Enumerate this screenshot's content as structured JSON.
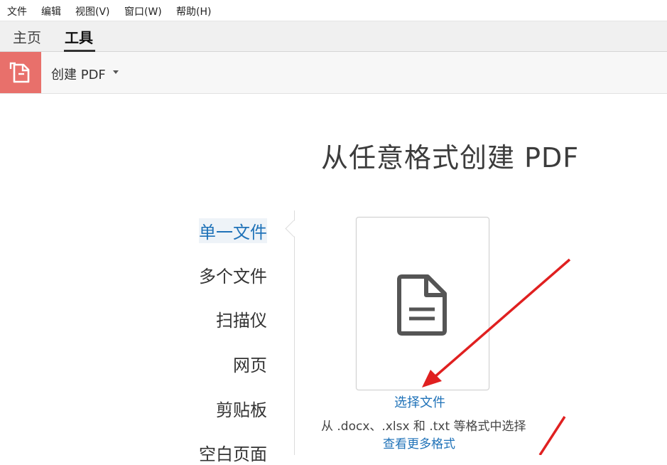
{
  "menubar": {
    "items": [
      "文件",
      "编辑",
      "视图(V)",
      "窗口(W)",
      "帮助(H)"
    ]
  },
  "tabs": [
    {
      "label": "主页"
    },
    {
      "label": "工具"
    }
  ],
  "toolbar": {
    "tool_name": "创建 PDF"
  },
  "main": {
    "title": "从任意格式创建 PDF",
    "options": [
      "单一文件",
      "多个文件",
      "扫描仪",
      "网页",
      "剪贴板",
      "空白页面"
    ],
    "selected_option": "单一文件",
    "select_file_label": "选择文件",
    "formats_text": "从 .docx、.xlsx 和 .txt 等格式中选择",
    "more_formats_label": "查看更多格式"
  },
  "colors": {
    "accent_red": "#e8706b",
    "link_blue": "#1f72b8",
    "arrow_red": "#e02020"
  },
  "icons": {
    "tool_icon": "create-pdf-icon",
    "document_icon": "document-icon"
  }
}
